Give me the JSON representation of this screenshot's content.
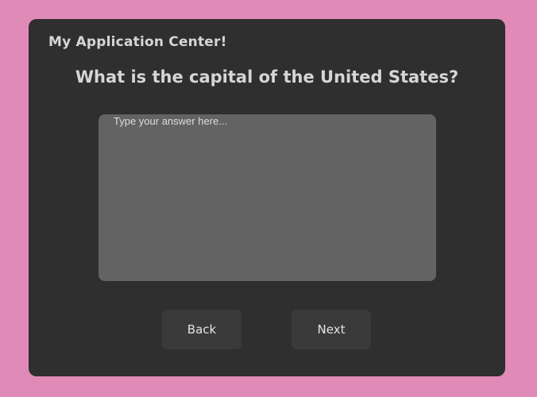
{
  "app": {
    "title": "My Application Center!"
  },
  "question": {
    "text": "What is the capital of the United States?"
  },
  "answer": {
    "value": "",
    "placeholder": "Type your answer here..."
  },
  "buttons": {
    "back_label": "Back",
    "next_label": "Next"
  },
  "colors": {
    "page_background": "#e08bb7",
    "panel_background": "#2f2f2f",
    "input_background": "#636363",
    "button_background": "#3a3a3a",
    "text": "#d6d6d6"
  }
}
